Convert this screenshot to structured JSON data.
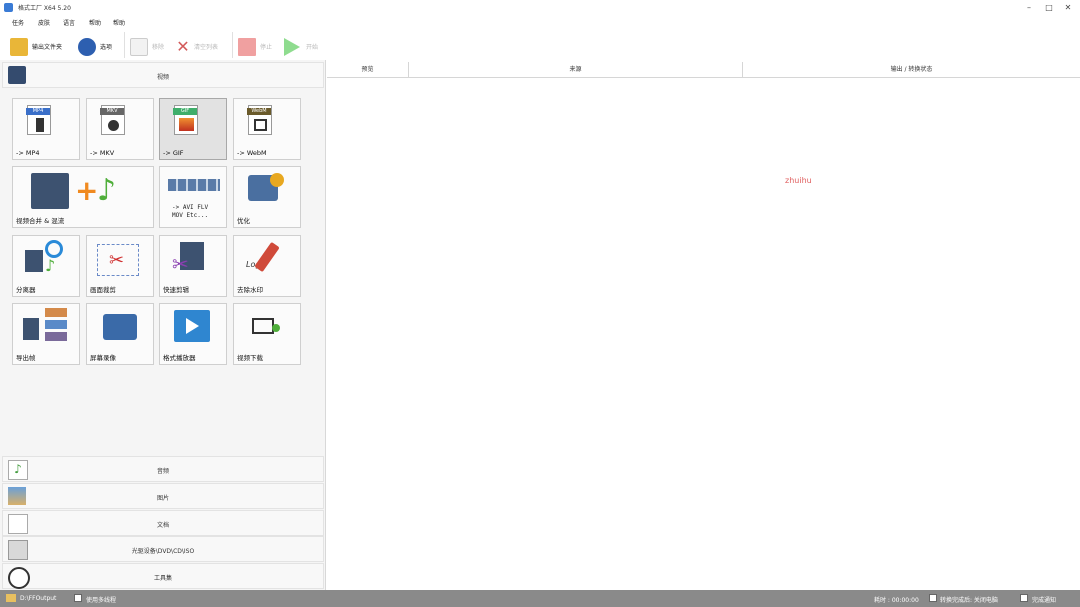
{
  "window": {
    "title": "格式工厂 X64 5.20",
    "controls": [
      "–",
      "□",
      "✕"
    ]
  },
  "menu": [
    "任务",
    "皮肤",
    "语言",
    "帮助",
    "帮助"
  ],
  "toolbar": {
    "output_folder": "输出文件夹",
    "options": "选项",
    "remove": "移除",
    "clear_list": "清空列表",
    "stop": "停止",
    "start": "开始"
  },
  "categories": {
    "video": "视频",
    "audio": "音频",
    "image": "图片",
    "document": "文档",
    "rom_device": "光驱设备\\DVD\\CD\\ISO",
    "toolbox": "工具集"
  },
  "tiles": {
    "mp4": "-> MP4",
    "mkv": "-> MKV",
    "gif": "-> GIF",
    "webm": "-> WebM",
    "join_mux": "视频合并 & 混流",
    "avi_flv_line1": "-> AVI FLV",
    "avi_flv_line2": "MOV Etc...",
    "optimize": "优化",
    "splitter": "分离器",
    "crop": "画面裁剪",
    "quick_clip": "快速剪辑",
    "remove_logo": "去除水印",
    "export_frames": "导出帧",
    "screen_record": "屏幕录像",
    "player": "格式播放器",
    "video_download": "视频下载"
  },
  "tile_badges": {
    "mp4": "MP4",
    "mkv": "MKV",
    "gif": "GIF",
    "webm": "WebM",
    "logo": "Logo"
  },
  "table": {
    "columns": [
      "预览",
      "来源",
      "输出 / 转换状态"
    ]
  },
  "watermark": "zhuihu",
  "statusbar": {
    "output_path": "D:\\FFOutput",
    "multithread": "使用多线程",
    "elapsed": "耗时 : 00:00:00",
    "shutdown": "转换完成后: 关闭电脑",
    "notify": "完成通知"
  },
  "colors": {
    "mp4_badge": "#3a6fc9",
    "mkv_badge": "#666666",
    "gif_badge": "#3fae6a",
    "webm_badge": "#6a5a2a",
    "statusbar": "#8a8a8a",
    "watermark": "#e06060"
  }
}
